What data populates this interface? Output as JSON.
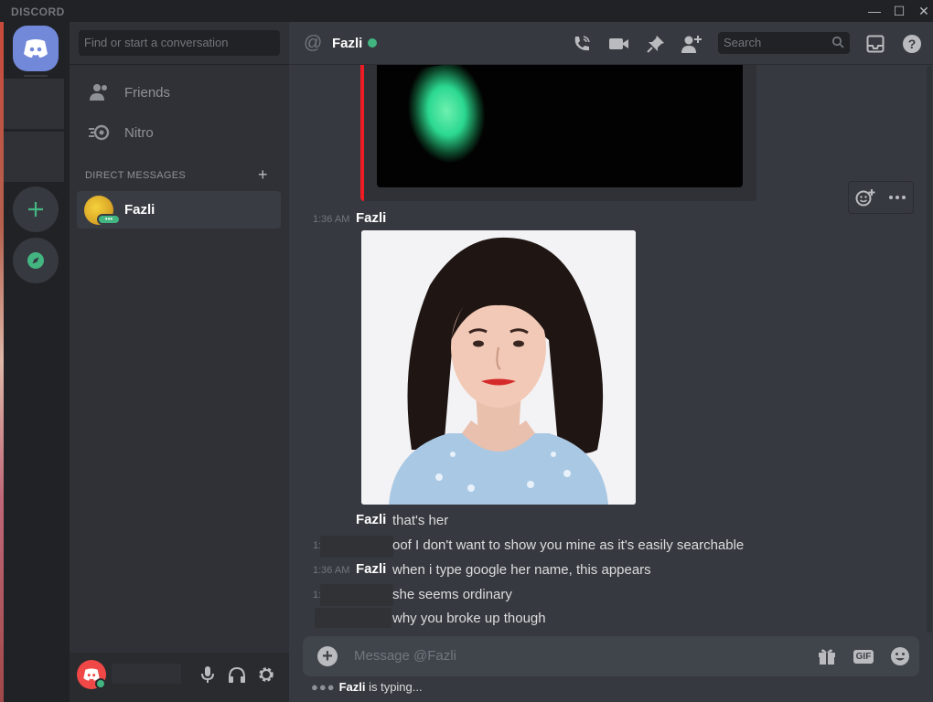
{
  "app": {
    "brand": "DISCORD"
  },
  "window": {
    "minimize": "—",
    "maximize": "☐",
    "close": "✕"
  },
  "dm_panel": {
    "search_placeholder": "Find or start a conversation",
    "nav": [
      {
        "label": "Friends",
        "icon": "friends-icon"
      },
      {
        "label": "Nitro",
        "icon": "nitro-icon"
      }
    ],
    "section_header": "DIRECT MESSAGES",
    "add_dm": "+",
    "conversations": [
      {
        "name": "Fazli",
        "status": "mobile-online"
      }
    ]
  },
  "chat_header": {
    "name": "Fazli",
    "status_color": "#43b581",
    "search_placeholder": "Search",
    "icons": [
      "call-icon",
      "video-icon",
      "pin-icon",
      "add-friend-icon",
      "inbox-icon",
      "help-icon"
    ]
  },
  "messages": [
    {
      "time": "1:36 AM",
      "author": "Fazli",
      "text": "",
      "attachment": "photo"
    },
    {
      "time": "",
      "author": "Fazli",
      "text": "that's her"
    },
    {
      "time": "1:",
      "author": "",
      "text": "oof I don't want to show you mine as it's easily searchable"
    },
    {
      "time": "1:36 AM",
      "author": "Fazli",
      "text": "when i type google her name, this appears"
    },
    {
      "time": "1:",
      "author": "",
      "text": "she seems ordinary"
    },
    {
      "time": "",
      "author": "",
      "text": "why you broke up though"
    }
  ],
  "composer": {
    "placeholder": "Message @Fazli",
    "gif_label": "GIF"
  },
  "typing": {
    "dots": "●●●",
    "user": "Fazli",
    "suffix": " is typing..."
  },
  "colors": {
    "accent": "#7289da",
    "online": "#43b581",
    "embed_border": "#ed1c24",
    "danger": "#f04747"
  }
}
